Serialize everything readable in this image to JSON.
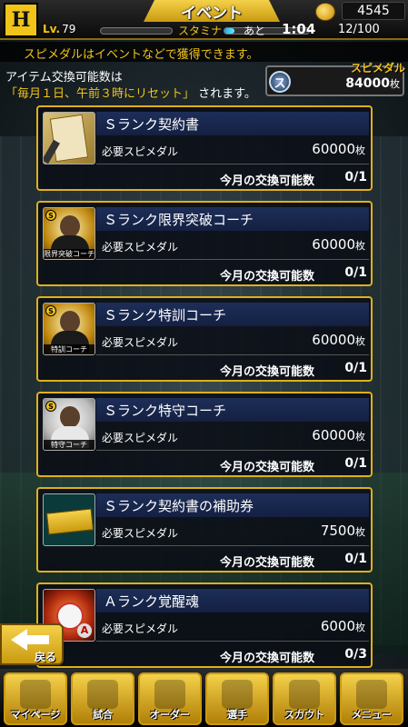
{
  "header": {
    "title": "イベント",
    "level_label": "Lv.",
    "level": "79",
    "stamina_label": "スタミナ",
    "ato_label": "あと",
    "timer": "1:04",
    "stamina_value": "12/100",
    "stamina_fill": 0.12,
    "coins": "4545",
    "team_logo": "H"
  },
  "info": {
    "banner": "スピメダルはイベントなどで獲得できます。",
    "note_line1": "アイテム交換可能数は",
    "note_line2_highlight": "「毎月１日、午前３時にリセット」",
    "note_line2_rest": "されます。",
    "medal_title": "スピメダル",
    "medal_icon_text": "ス",
    "medal_value": "84000",
    "medal_unit": "枚"
  },
  "common": {
    "req_label": "必要スピメダル",
    "unit": "枚",
    "limit_label": "今月の交換可能数"
  },
  "items": [
    {
      "name": "Ｓランク契約書",
      "cost": "60000",
      "limit": "0/1"
    },
    {
      "name": "Ｓランク限界突破コーチ",
      "cost": "60000",
      "limit": "0/1",
      "tag": "限界突破コーチ"
    },
    {
      "name": "Ｓランク特訓コーチ",
      "cost": "60000",
      "limit": "0/1",
      "tag": "特訓コーチ"
    },
    {
      "name": "Ｓランク特守コーチ",
      "cost": "60000",
      "limit": "0/1",
      "tag": "特守コーチ"
    },
    {
      "name": "Ｓランク契約書の補助券",
      "cost": "7500",
      "limit": "0/1"
    },
    {
      "name": "Ａランク覚醒魂",
      "cost": "6000",
      "limit": "0/3"
    }
  ],
  "back_label": "戻る",
  "nav": [
    {
      "label": "マイページ"
    },
    {
      "label": "試合"
    },
    {
      "label": "オーダー"
    },
    {
      "label": "選手"
    },
    {
      "label": "スカウト"
    },
    {
      "label": "メニュー"
    }
  ]
}
